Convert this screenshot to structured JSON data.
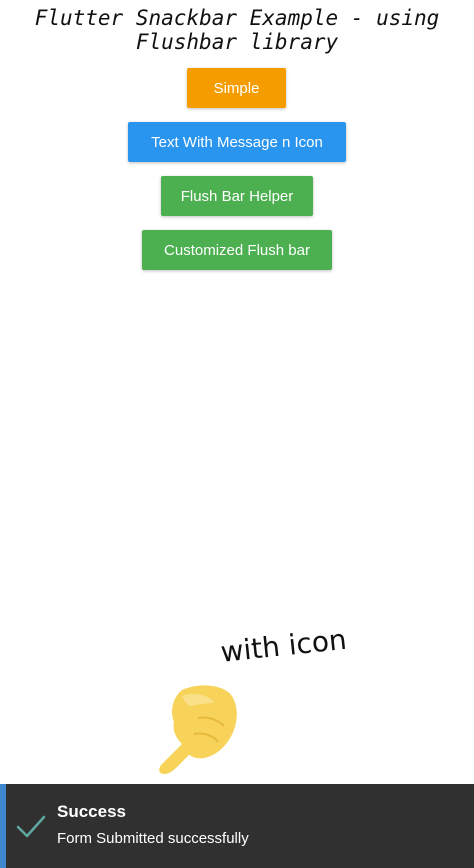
{
  "app_title": {
    "line1": "Flutter Snackbar Example - using",
    "line2": "Flushbar library"
  },
  "buttons": {
    "simple": "Simple",
    "text_with_message": "Text With Message n Icon",
    "flush_bar_helper": "Flush Bar Helper",
    "customized_flush_bar": "Customized Flush bar"
  },
  "annotation": {
    "text": "with icon",
    "icon": "pointing-hand-icon"
  },
  "flushbar": {
    "title": "Success",
    "message": "Form Submitted successfully",
    "icon": "check-icon",
    "accent_color": "#3e86cf",
    "icon_color": "#5fa8a0"
  },
  "colors": {
    "simple_button": "#f59d00",
    "text_icon_button": "#2a95ee",
    "green_button": "#4caf50",
    "flushbar_background": "#303030"
  }
}
